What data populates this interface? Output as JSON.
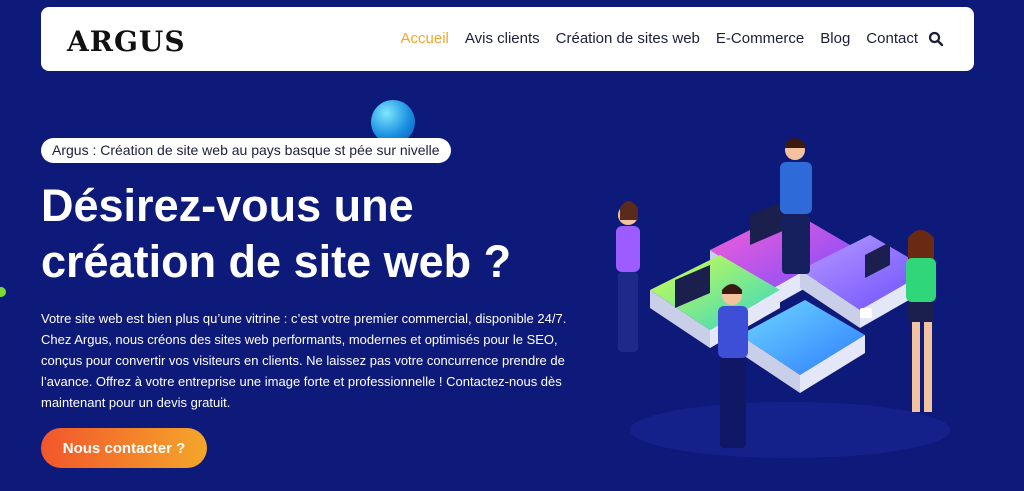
{
  "header": {
    "logo": "ARGUS",
    "nav": [
      "Accueil",
      "Avis clients",
      "Création de sites web",
      "E-Commerce",
      "Blog",
      "Contact"
    ],
    "active_index": 0,
    "search_icon": "search-icon"
  },
  "hero": {
    "tagline": "Argus : Création de site web au pays basque st pée sur nivelle",
    "headline_line1": "Désirez-vous une",
    "headline_line2": "création de site web ?",
    "body": "Votre site web est bien plus qu’une vitrine : c’est votre premier commercial, disponible 24/7. Chez Argus, nous créons des sites web performants, modernes et optimisés pour le SEO, conçus pour convertir vos visiteurs en clients. Ne laissez pas votre concurrence prendre de l’avance. Offrez à votre entreprise une image forte et professionnelle ! Contactez-nous dès maintenant pour un devis gratuit.",
    "cta_label": "Nous contacter ?"
  },
  "colors": {
    "background": "#0e1a7a",
    "accent": "#f4a62a",
    "cta_start": "#f2562b",
    "cta_end": "#f4a62a"
  }
}
